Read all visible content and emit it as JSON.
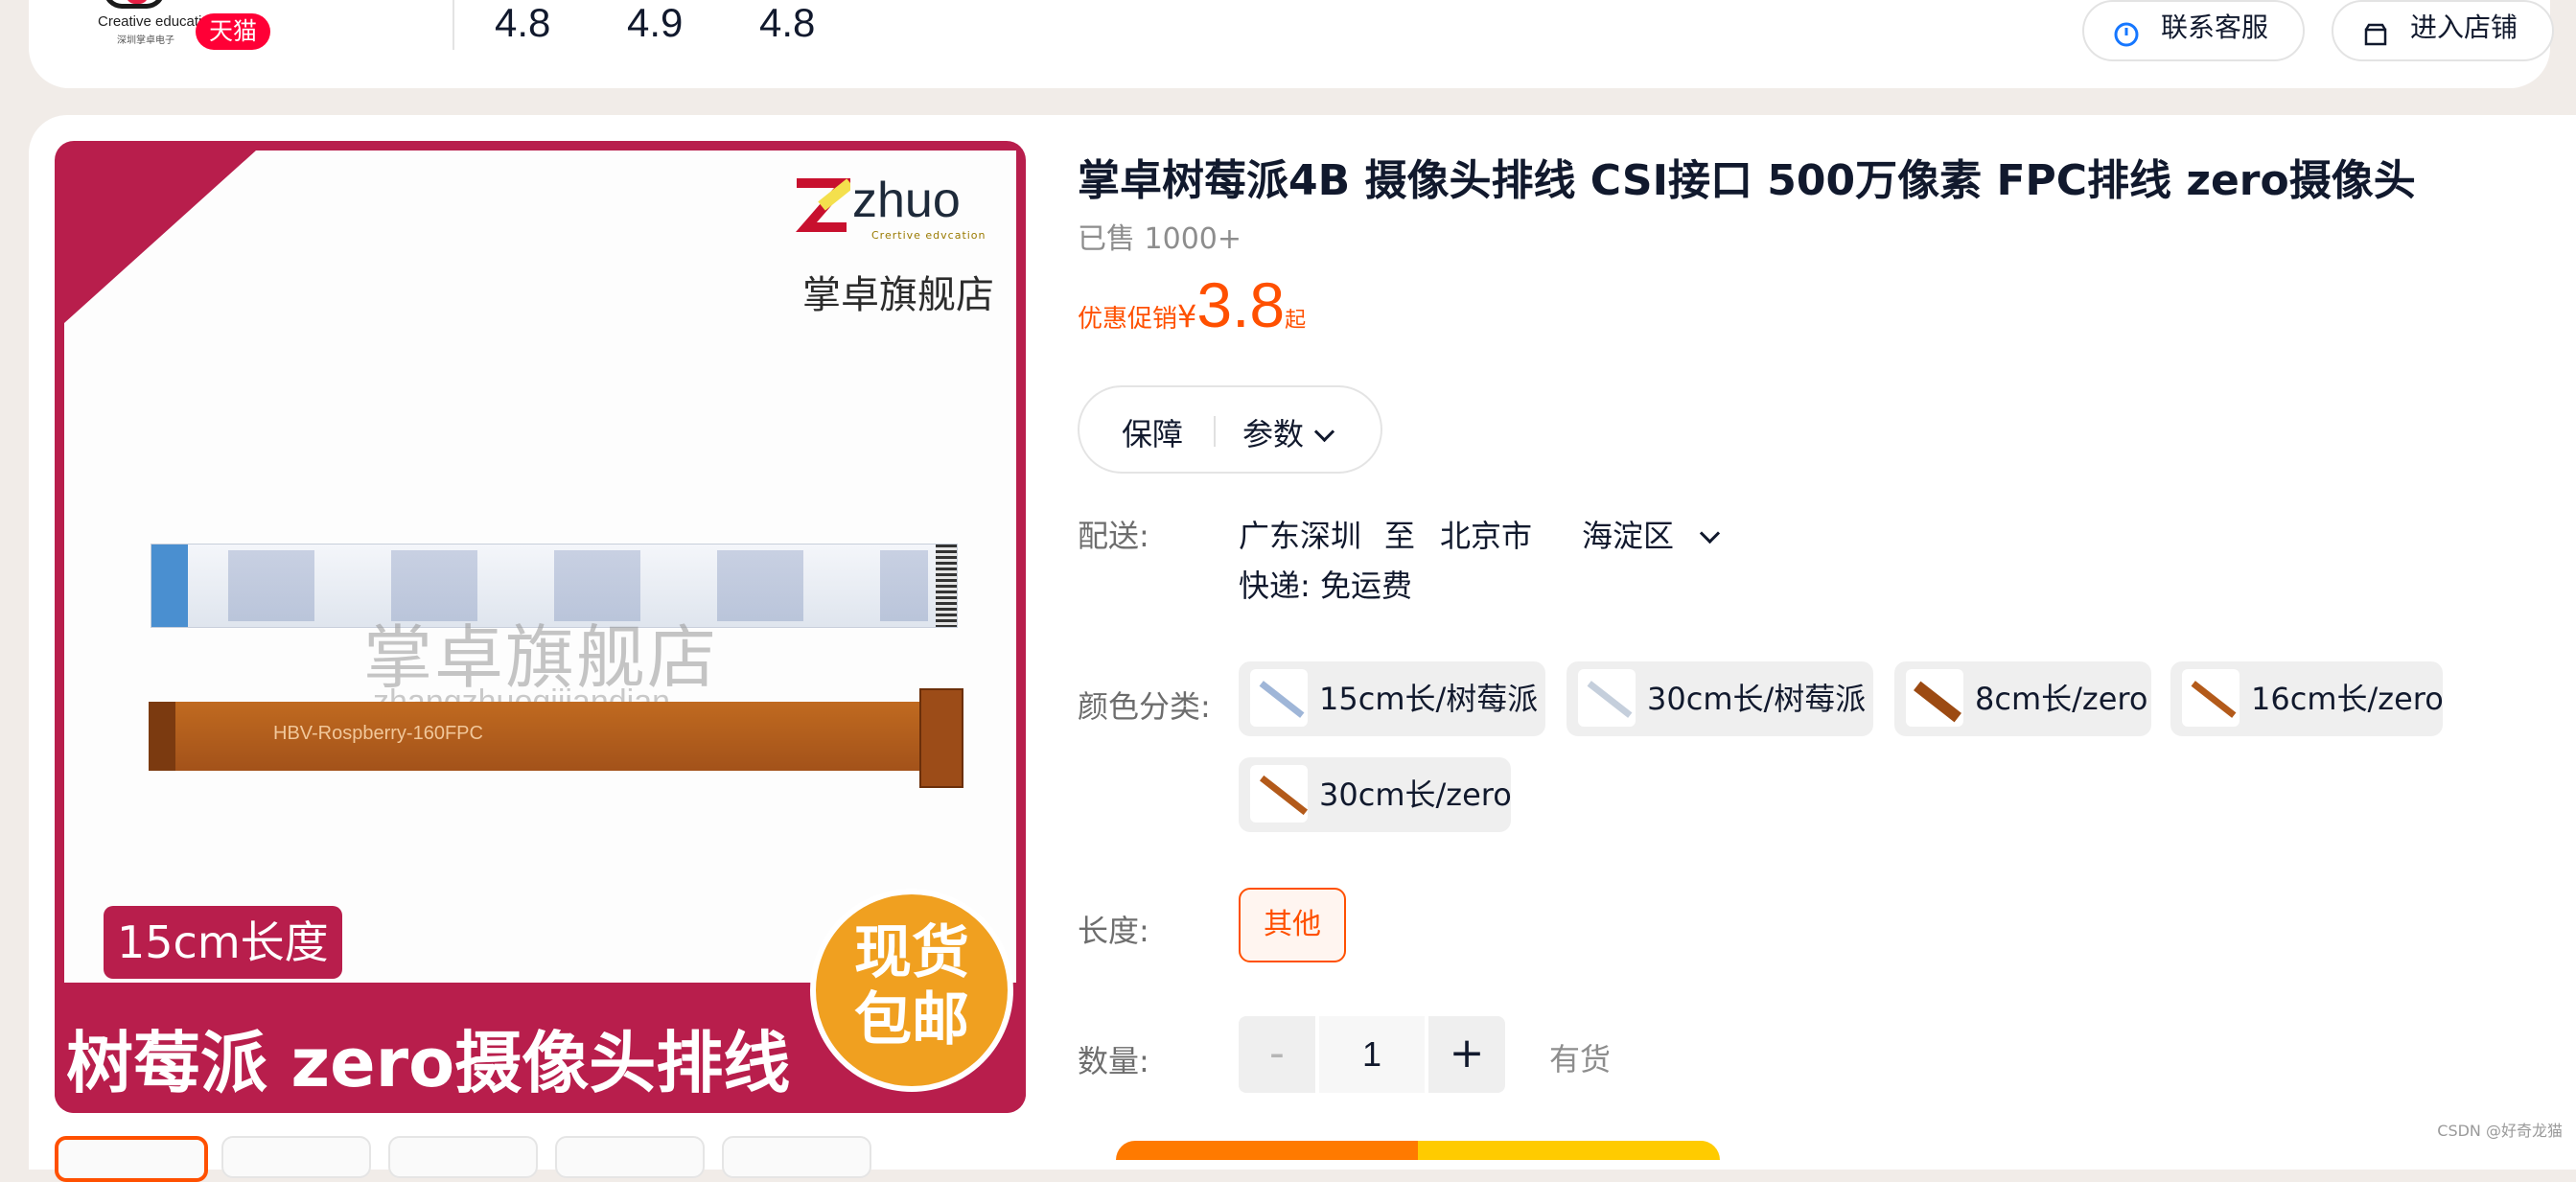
{
  "store": {
    "logo_text": "Creative education",
    "logo_subtext": "深圳掌卓电子",
    "badge": "天猫",
    "scores": [
      "4.8",
      "4.9",
      "4.8"
    ],
    "contact_button": "联系客服",
    "enter_store_button": "进入店铺"
  },
  "gallery": {
    "brand_word": "zhuo",
    "brand_tag": "Crertive edvcation",
    "brand_store": "掌卓旗舰店",
    "watermark": "掌卓旗舰店",
    "watermark_pinyin": "zhangzhuoqijiandian",
    "cable_label": "HBV-Rospberry-160FPC",
    "length_badge": "15cm长度",
    "banner_text": "树莓派 zero摄像头排线",
    "stock_line1": "现货",
    "stock_line2": "包邮"
  },
  "product": {
    "title": "掌卓树莓派4B 摄像头排线 CSI接口 500万像素 FPC排线 zero摄像头",
    "sold": "已售 1000+",
    "price_label": "优惠促销",
    "price_currency": "¥",
    "price_value": "3.8",
    "price_suffix": "起"
  },
  "tabs": {
    "guarantee": "保障",
    "params": "参数"
  },
  "shipping": {
    "label": "配送:",
    "from": "广东深圳",
    "to_word": "至",
    "city": "北京市",
    "district": "海淀区",
    "express": "快递: 免运费"
  },
  "color": {
    "label": "颜色分类:",
    "options": [
      "15cm长/树莓派",
      "30cm长/树莓派",
      "8cm长/zero",
      "16cm长/zero",
      "30cm长/zero"
    ]
  },
  "length": {
    "label": "长度:",
    "option": "其他"
  },
  "quantity": {
    "label": "数量:",
    "minus": "-",
    "value": "1",
    "plus": "+",
    "stock": "有货"
  },
  "credit": "CSDN @好奇龙猫",
  "colors": {
    "accent": "#ff5000",
    "brand": "#b81e4c",
    "tmall": "#ff0036"
  }
}
